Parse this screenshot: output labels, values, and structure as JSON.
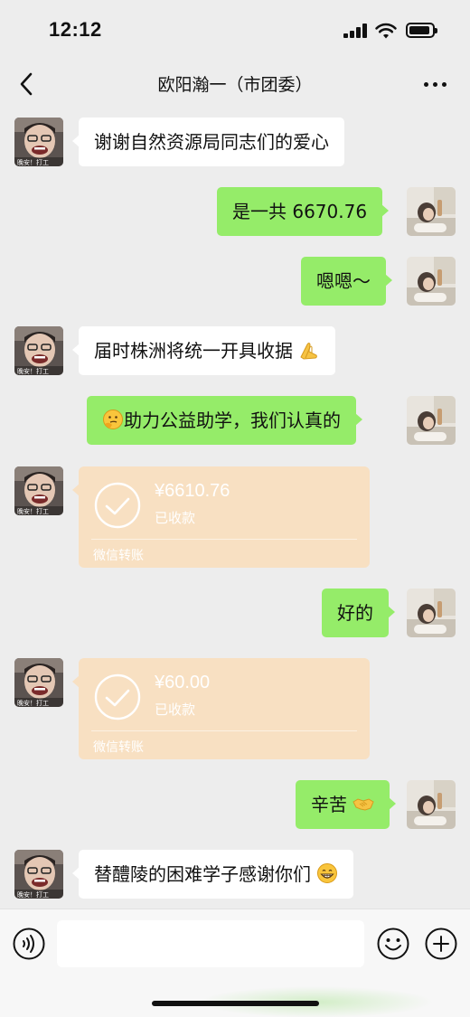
{
  "status_bar": {
    "time": "12:12"
  },
  "nav": {
    "title": "欧阳瀚一（市团委）"
  },
  "messages": [
    {
      "sender": "other",
      "type": "text",
      "text": "谢谢自然资源局同志们的爱心"
    },
    {
      "sender": "me",
      "type": "text",
      "text": "是一共 6670.76"
    },
    {
      "sender": "me",
      "type": "text",
      "text": "嗯嗯～"
    },
    {
      "sender": "other",
      "type": "text",
      "text": "届时株洲将统一开具收据",
      "emoji": "praying-hands-emoji"
    },
    {
      "sender": "me",
      "type": "text",
      "text": "助力公益助学，我们认真的",
      "emoji_before": "thinking-face-emoji"
    },
    {
      "sender": "other",
      "type": "transfer",
      "amount": "¥6610.76",
      "status": "已收款",
      "label": "微信转账"
    },
    {
      "sender": "me",
      "type": "text",
      "text": "好的"
    },
    {
      "sender": "other",
      "type": "transfer",
      "amount": "¥60.00",
      "status": "已收款",
      "label": "微信转账"
    },
    {
      "sender": "me",
      "type": "text",
      "text": "辛苦",
      "emoji": "handshake-emoji"
    },
    {
      "sender": "other",
      "type": "text",
      "text": "替醴陵的困难学子感谢你们",
      "emoji": "grinning-face-emoji"
    }
  ],
  "avatars": {
    "other_caption": "晚安！打工"
  },
  "input_bar": {
    "placeholder": ""
  },
  "colors": {
    "background": "#ededed",
    "my_bubble": "#95ec69",
    "other_bubble": "#ffffff",
    "transfer_card": "#f8e0c2"
  }
}
